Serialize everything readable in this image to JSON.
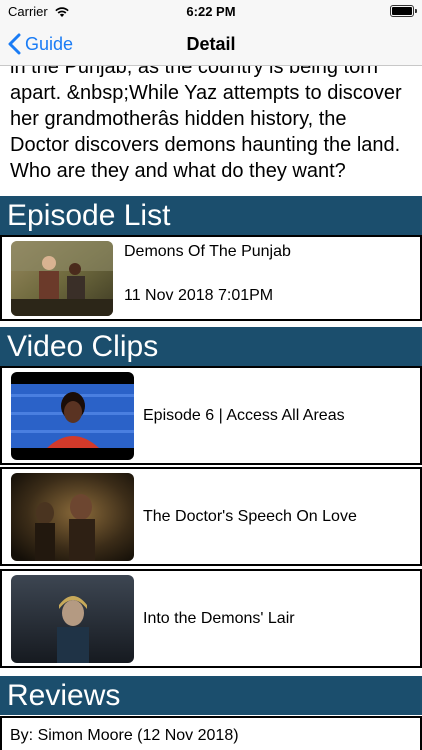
{
  "status_bar": {
    "carrier": "Carrier",
    "time": "6:22 PM"
  },
  "nav": {
    "back_label": "Guide",
    "title": "Detail"
  },
  "description": "in the Punjab, as the country is being torn apart. &nbsp;While Yaz attempts to discover her grandmotherâs hidden history, the Doctor discovers demons haunting the land. Who are they and what do they want?",
  "episode_list": {
    "header": "Episode List",
    "items": [
      {
        "title": "Demons Of The Punjab",
        "date": "11 Nov 2018 7:01PM"
      }
    ]
  },
  "video_clips": {
    "header": "Video Clips",
    "items": [
      {
        "title": "Episode 6 | Access All Areas"
      },
      {
        "title": "The Doctor's Speech On Love"
      },
      {
        "title": "Into the Demons' Lair"
      }
    ]
  },
  "reviews": {
    "header": "Reviews",
    "items": [
      {
        "by": "By: Simon Moore (12 Nov 2018)"
      }
    ]
  },
  "icons": [
    "wifi-icon",
    "battery-icon",
    "chevron-left-icon"
  ],
  "colors": {
    "accent": "#1a7cf5",
    "section_header": "#1b4e6d"
  }
}
